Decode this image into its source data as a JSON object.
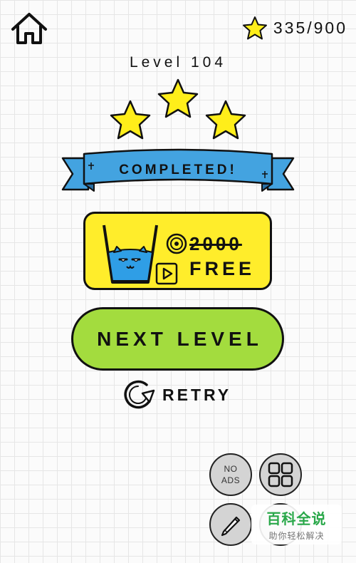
{
  "header": {
    "home_icon": "home-icon",
    "stars_collected": "335/900",
    "star_icon": "star-icon"
  },
  "level": {
    "title": "Level 104",
    "stars_earned": 3,
    "stars_total": 3,
    "status": "COMPLETED!"
  },
  "reward_button": {
    "price": "2000",
    "price_icon": "coin-icon",
    "label": "FREE",
    "video_icon": "play-icon"
  },
  "next_button": {
    "label": "NEXT LEVEL"
  },
  "retry_button": {
    "label": "RETRY",
    "icon": "retry-icon"
  },
  "round_buttons": {
    "no_ads_line1": "NO",
    "no_ads_line2": "ADS"
  },
  "watermark": {
    "title": "百科全说",
    "subtitle": "助你轻松解决"
  },
  "colors": {
    "star_yellow": "#ffee1a",
    "ribbon_blue": "#43a3e0",
    "free_yellow": "#ffed2b",
    "next_green": "#a3dc3e",
    "water_blue": "#2f9ee6",
    "round_gray": "#d4d4d4"
  }
}
